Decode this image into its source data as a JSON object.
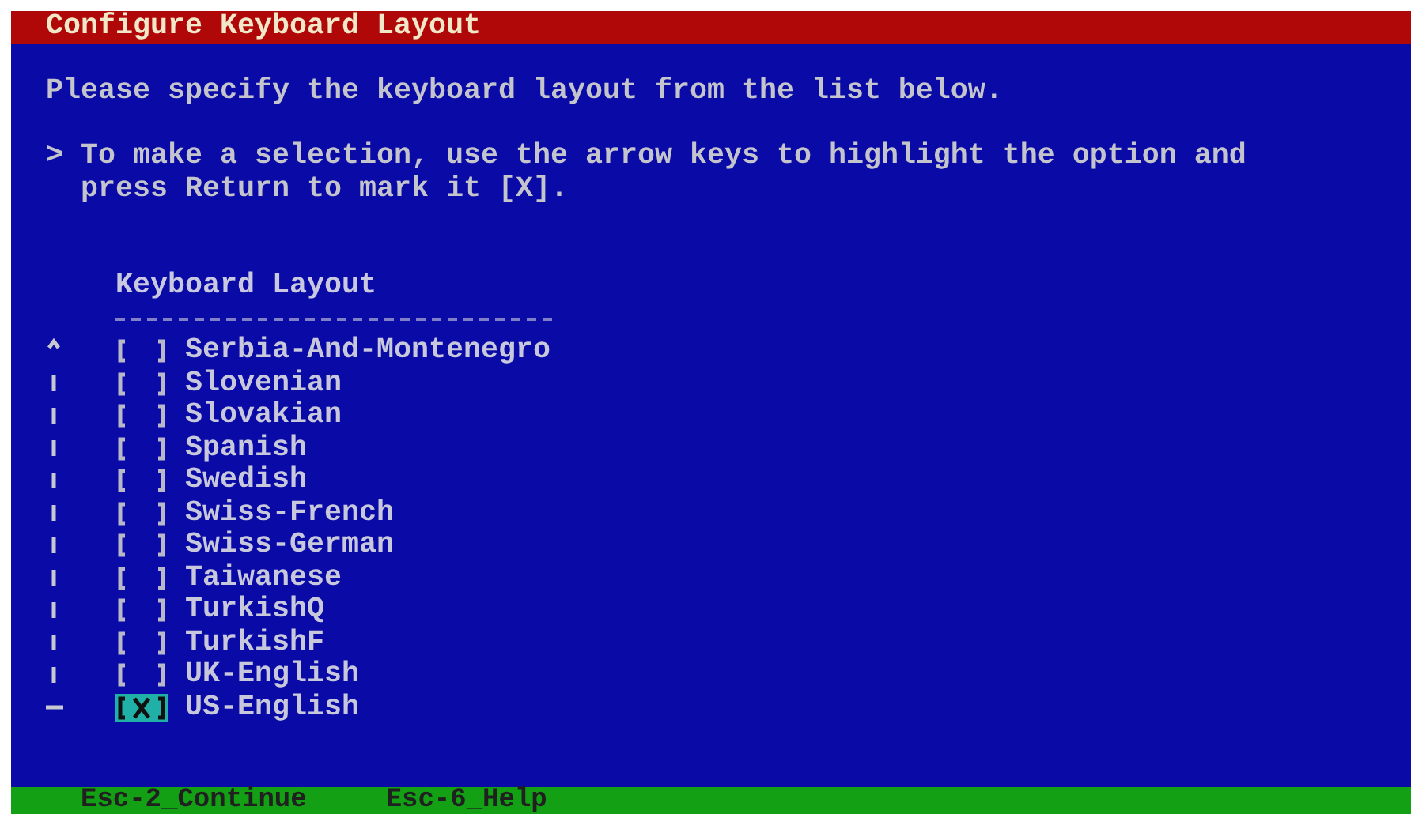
{
  "window": {
    "title": "Configure Keyboard Layout"
  },
  "instruction": "Please specify the keyboard layout from the list below.",
  "hint": {
    "marker": ">",
    "text": "To make a selection, use the arrow keys to highlight the option and press Return to mark it [X]."
  },
  "list": {
    "heading": "Keyboard Layout",
    "items": [
      {
        "label": "Serbia-And-Montenegro",
        "checked": false,
        "selected": false
      },
      {
        "label": "Slovenian",
        "checked": false,
        "selected": false
      },
      {
        "label": "Slovakian",
        "checked": false,
        "selected": false
      },
      {
        "label": "Spanish",
        "checked": false,
        "selected": false
      },
      {
        "label": "Swedish",
        "checked": false,
        "selected": false
      },
      {
        "label": "Swiss-French",
        "checked": false,
        "selected": false
      },
      {
        "label": "Swiss-German",
        "checked": false,
        "selected": false
      },
      {
        "label": "Taiwanese",
        "checked": false,
        "selected": false
      },
      {
        "label": "TurkishQ",
        "checked": false,
        "selected": false
      },
      {
        "label": "TurkishF",
        "checked": false,
        "selected": false
      },
      {
        "label": "UK-English",
        "checked": false,
        "selected": false
      },
      {
        "label": "US-English",
        "checked": true,
        "selected": true
      }
    ]
  },
  "status_bar": {
    "keys": [
      {
        "label": "Esc-2_Continue"
      },
      {
        "label": "Esc-6_Help"
      }
    ]
  }
}
